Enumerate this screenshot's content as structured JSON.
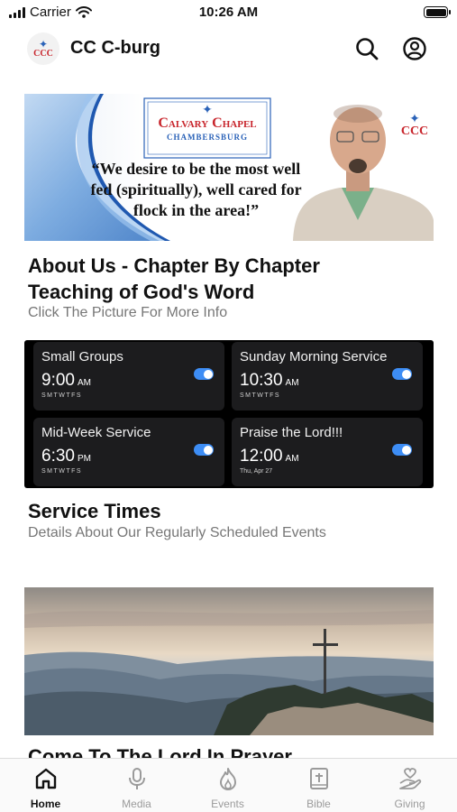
{
  "status_bar": {
    "carrier": "Carrier",
    "time": "10:26 AM"
  },
  "header": {
    "logo_text": "CCC",
    "title": "CC C-burg"
  },
  "banner": {
    "church_name_line1": "Calvary Chapel",
    "church_name_line2": "CHAMBERSBURG",
    "quote_line1": "“We desire to be the most well",
    "quote_line2": "fed (spiritually), well cared for",
    "quote_line3": "flock in the area!”",
    "badge_text": "CCC"
  },
  "about": {
    "title_line1": "About Us - Chapter By Chapter",
    "title_line2": "Teaching of God's Word",
    "subtitle": "Click The Picture For More Info"
  },
  "services": {
    "items": [
      {
        "name": "Small Groups",
        "time": "9:00",
        "ampm": "AM",
        "days": "SMTWTFS",
        "enabled": true
      },
      {
        "name": "Sunday Morning Service",
        "time": "10:30",
        "ampm": "AM",
        "days": "SMTWTFS",
        "enabled": true
      },
      {
        "name": "Mid-Week Service",
        "time": "6:30",
        "ampm": "PM",
        "days": "SMTWTFS",
        "enabled": true
      },
      {
        "name": "Praise the Lord!!!",
        "time": "12:00",
        "ampm": "AM",
        "days": "Thu, Apr 27",
        "enabled": true
      }
    ],
    "title": "Service Times",
    "subtitle": "Details About Our Regularly Scheduled Events"
  },
  "prayer": {
    "title": "Come To The Lord In Prayer"
  },
  "tabs": [
    {
      "label": "Home",
      "icon": "home-icon",
      "active": true
    },
    {
      "label": "Media",
      "icon": "microphone-icon",
      "active": false
    },
    {
      "label": "Events",
      "icon": "flame-icon",
      "active": false
    },
    {
      "label": "Bible",
      "icon": "bible-icon",
      "active": false
    },
    {
      "label": "Giving",
      "icon": "giving-hand-icon",
      "active": false
    }
  ],
  "colors": {
    "accent": "#3d8df5",
    "logo_red": "#c8252c",
    "logo_blue": "#2a62b8",
    "inactive": "#9a9a9a"
  }
}
